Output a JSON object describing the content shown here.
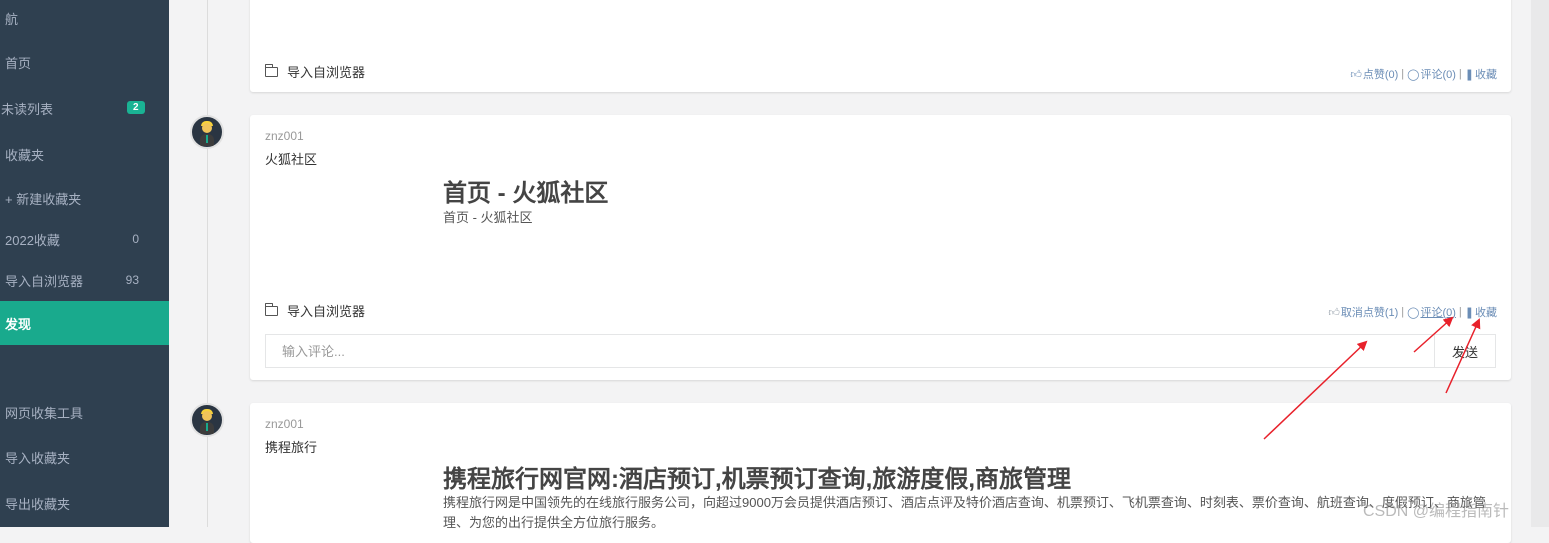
{
  "sidebar": {
    "items": [
      {
        "label": "航",
        "count": ""
      },
      {
        "label": "首页",
        "count": ""
      },
      {
        "label": "未读列表",
        "badge": "2"
      },
      {
        "label": "收藏夹",
        "count": ""
      },
      {
        "label": "+ 新建收藏夹",
        "count": ""
      },
      {
        "label": "2022收藏",
        "count": "0"
      },
      {
        "label": "导入自浏览器",
        "count": "93"
      },
      {
        "label": "发现",
        "count": "",
        "active": true
      },
      {
        "label": "网页收集工具",
        "count": ""
      },
      {
        "label": "导入收藏夹",
        "count": ""
      },
      {
        "label": "导出收藏夹",
        "count": ""
      }
    ],
    "colors": {
      "bg": "#2f4050",
      "active": "#19aa8d",
      "badge": "#1ab394"
    }
  },
  "feed": {
    "card0": {
      "folder": "导入自浏览器",
      "like": "点赞(0)",
      "comment": "评论(0)",
      "collect": "收藏"
    },
    "card1": {
      "username": "znz001",
      "site": "火狐社区",
      "title": "首页 - 火狐社区",
      "description": "首页 - 火狐社区",
      "folder": "导入自浏览器",
      "unlike": "取消点赞(1)",
      "comment": "评论(0)",
      "collect": "收藏",
      "comment_placeholder": "输入评论...",
      "send": "发送"
    },
    "card2": {
      "username": "znz001",
      "site": "携程旅行",
      "title": "携程旅行网官网:酒店预订,机票预订查询,旅游度假,商旅管理",
      "description": "携程旅行网是中国领先的在线旅行服务公司，向超过9000万会员提供酒店预订、酒店点评及特价酒店查询、机票预订、飞机票查询、时刻表、票价查询、航班查询、度假预订、商旅管理、为您的出行提供全方位旅行服务。"
    }
  },
  "annotation_color": "#e8212b",
  "watermark": "CSDN @编程指南针"
}
